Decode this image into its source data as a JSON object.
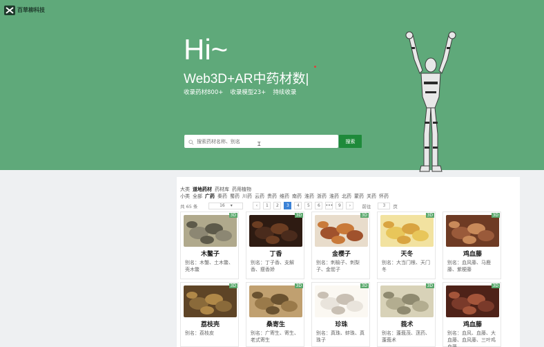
{
  "header": {
    "logo_text": "百草柳科技"
  },
  "hero": {
    "greeting": "Hi~",
    "subtitle": "Web3D+AR中药材数|",
    "stats": [
      "收录药材800+",
      "收录模型23+",
      "持续收录"
    ],
    "search_placeholder": "搜索药材名称、别名",
    "search_button": "搜索"
  },
  "filters": {
    "row1_label": "大类",
    "row1": [
      "道地药材",
      "药材库",
      "药用植物"
    ],
    "row1_active": 0,
    "row2_label": "小类",
    "row2": [
      "全部",
      "广药",
      "秦药",
      "蜀药",
      "川药",
      "云药",
      "贵药",
      "维药",
      "南药",
      "淮药",
      "浙药",
      "淮药",
      "北药",
      "蒙药",
      "关药",
      "怀药"
    ],
    "row2_active": 1
  },
  "pagination": {
    "total_label": "共 65 条",
    "page_size": "16",
    "pages": [
      "1",
      "2",
      "3",
      "4",
      "5",
      "6",
      "•••",
      "9"
    ],
    "active_page": "3",
    "goto_label": "前往",
    "goto_value": "3",
    "page_suffix": "页"
  },
  "cards": [
    {
      "name": "木鳖子",
      "alias": "别名：木蟹、土木鳖、壳木鳖",
      "badge": "3D",
      "colors": [
        "#8c8773",
        "#5d5a4a",
        "#b0a98c"
      ]
    },
    {
      "name": "丁香",
      "alias": "别名：丁子香、支解香、瘦香娇",
      "badge": "3D",
      "colors": [
        "#4a2b1c",
        "#6b3d22",
        "#2e1b12"
      ]
    },
    {
      "name": "金樱子",
      "alias": "别名：刺榆子、刺梨子、金罂子",
      "badge": "3D",
      "colors": [
        "#a0522d",
        "#c97a3a",
        "#e8dccb"
      ]
    },
    {
      "name": "天冬",
      "alias": "别名：大当门根、天门冬",
      "badge": "3D",
      "colors": [
        "#e8c65a",
        "#d9a441",
        "#f2e2a0"
      ]
    },
    {
      "name": "鸡血藤",
      "alias": "别名：血风藤、马鹿藤、紫梗藤",
      "badge": "3D",
      "colors": [
        "#9a5a3a",
        "#c98a5a",
        "#6e3b24"
      ]
    },
    {
      "name": "荔枝壳",
      "alias": "别名：荔枝皮",
      "badge": "3D",
      "colors": [
        "#8a6a3a",
        "#b08848",
        "#5e4426"
      ]
    },
    {
      "name": "桑寄生",
      "alias": "别名：广寄生、寄生、老式寄生",
      "badge": "3D",
      "colors": [
        "#9a7a4a",
        "#6a5230",
        "#c0a070"
      ]
    },
    {
      "name": "珍珠",
      "alias": "别名：真珠、蚌珠、真珠子",
      "badge": "3D",
      "colors": [
        "#e9e4dc",
        "#c9c0b4",
        "#fbf8f2"
      ]
    },
    {
      "name": "莪术",
      "alias": "别名：蓬莪茂、蒁药、蓬莪术",
      "badge": "3D",
      "colors": [
        "#b3ad90",
        "#8f8a70",
        "#d8d2b8"
      ]
    },
    {
      "name": "鸡血藤",
      "alias": "别名：血风、血藤、大血藤、血风藤、三叶鸡血藤",
      "badge": "3D",
      "colors": [
        "#7a3a2a",
        "#a4553a",
        "#4e2218"
      ]
    }
  ]
}
